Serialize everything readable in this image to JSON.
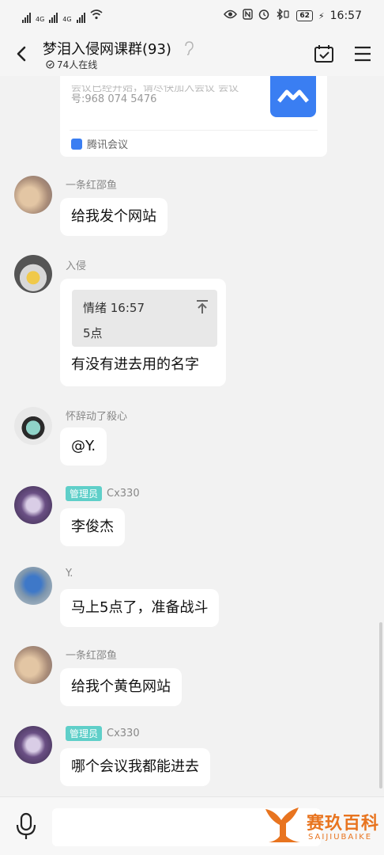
{
  "status_bar": {
    "network_1": "4G",
    "network_2": "4G",
    "battery": "62",
    "time": "16:57"
  },
  "header": {
    "title": "梦泪入侵网课群(93)",
    "online": "74人在线"
  },
  "meeting_card": {
    "text_cut": "会议已经开始，请尽快加入会议 会议",
    "text_line": "号:968 074 5476",
    "source": "腾讯会议"
  },
  "messages": [
    {
      "sender": "一条红邵鱼",
      "text": "给我发个网站"
    },
    {
      "sender": "入侵",
      "quote_head": "情绪 16:57",
      "quote_body": "5点",
      "text": "有没有进去用的名字"
    },
    {
      "sender": "怀辞动了殺心",
      "text": "@Y."
    },
    {
      "admin_tag": "管理员",
      "sender": "Cx330",
      "text": "李俊杰"
    },
    {
      "sender": "Y.",
      "text": "马上5点了，准备战斗"
    },
    {
      "sender": "一条红邵鱼",
      "text": "给我个黄色网站"
    },
    {
      "admin_tag": "管理员",
      "sender": "Cx330",
      "text": "哪个会议我都能进去"
    }
  ],
  "watermark": {
    "brand": "赛玖百科",
    "sub": "SAIJIUBAIKE"
  },
  "colors": {
    "admin_tag": "#5fcfc9",
    "meeting_blue": "#3a7ef2",
    "watermark": "#e8741f"
  }
}
